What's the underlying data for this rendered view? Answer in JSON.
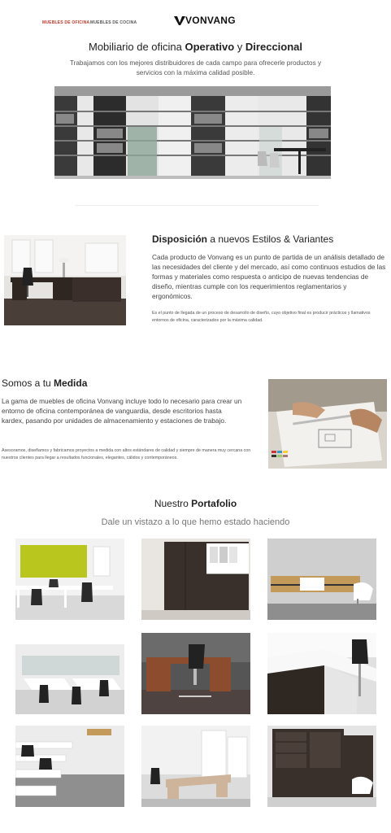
{
  "nav": {
    "link1": "MUEBLES DE OFICINA",
    "link2": "MUEBLES DE COCINA",
    "logo_text": "VONVANG"
  },
  "intro": {
    "title_pre": "Mobiliario de oficina ",
    "title_b1": "Operativo",
    "title_mid": " y ",
    "title_b2": "Direccional",
    "text": "Trabajamos con los mejores distribuidores de cada campo para ofrecerle productos y servicios con la máxima calidad posible."
  },
  "disposicion": {
    "title_b": "Disposición",
    "title_rest": " a nuevos Estilos & Variantes",
    "text": "Cada producto de Vonvang es un punto de partida de un análisis detallado de las necesidades del cliente y del mercado, así como continuos estudios de las formas y materiales como respuesta o anticipo de nuevas tendencias de diseño, mientras cumple con los requerimientos reglamentarios y ergonómicos.",
    "small": "Es el punto de llegada de un proceso de desarrollo de diseño, cuyo objetivo final es producir prácticos y llamativos entornos de oficina, caracterizados por la máxima calidad."
  },
  "medida": {
    "title_pre": "Somos a tu ",
    "title_b": "Medida",
    "text": "La gama de muebles de oficina Vonvang incluye todo lo necesario para crear un entorno de oficina contemporánea de vanguardia, desde escritorios hasta kardex, pasando por unidades de almacenamiento y estaciones de trabajo.",
    "small": "Asesoramos, diseñamos y fabricamos proyectos a medida con altos estándares de calidad y siempre de manera muy cercana con nuestros clientes para llegar a resultados funcionales, elegantes, cálidos y contemporáneos."
  },
  "portfolio": {
    "title_pre": "Nuestro ",
    "title_b": "Portafolio",
    "subtitle": "Dale un vistazo a lo que hemo estado haciendo"
  },
  "colors": {
    "accent_red": "#c0392b",
    "dark_wood": "#3a302b",
    "lime_wall": "#b8c61e"
  }
}
